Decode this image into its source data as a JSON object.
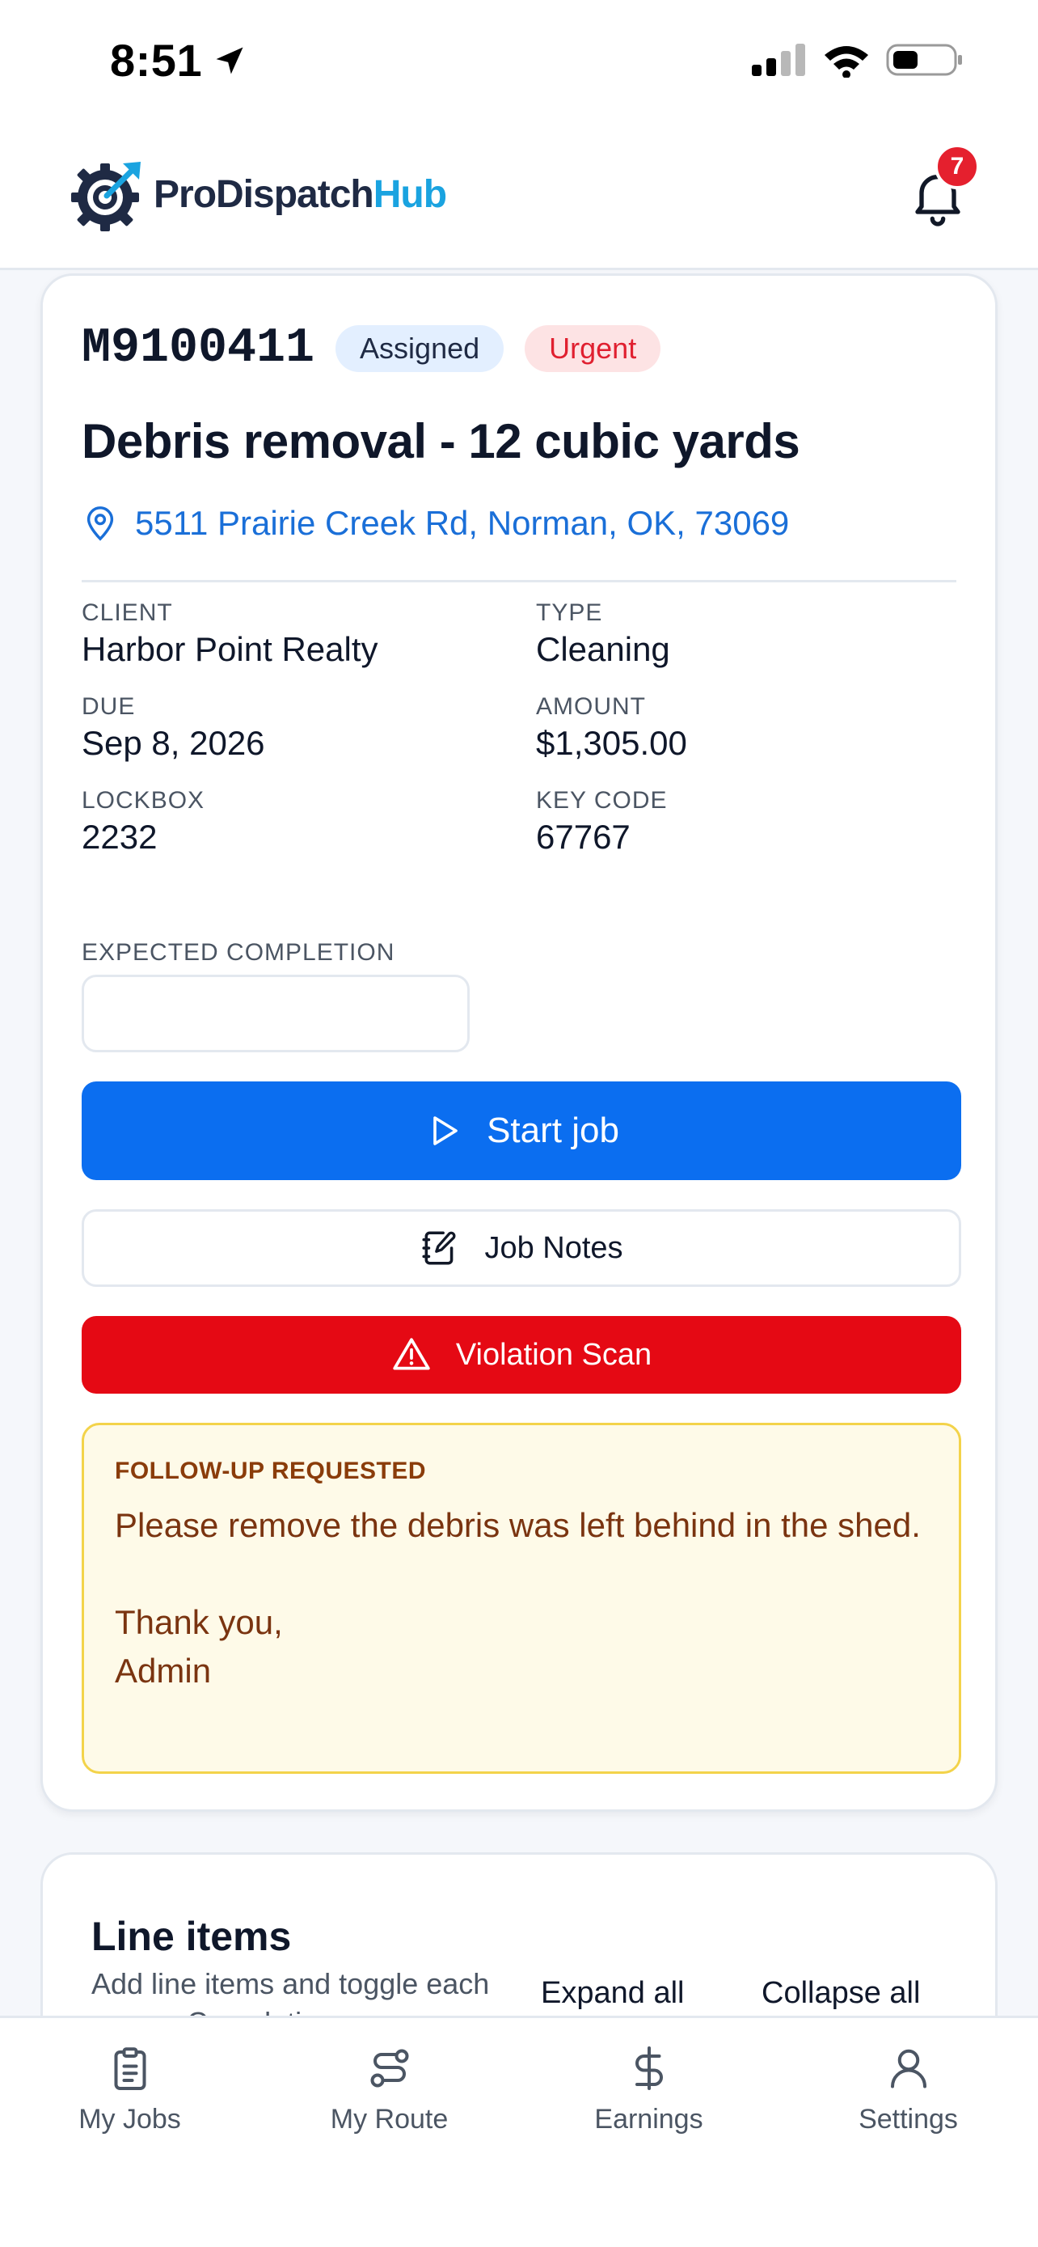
{
  "status_bar": {
    "time": "8:51"
  },
  "header": {
    "logo_pro": "ProDispatch",
    "logo_hub": "Hub",
    "notification_count": "7"
  },
  "job": {
    "id": "M9100411",
    "status": "Assigned",
    "priority": "Urgent",
    "title": "Debris removal - 12 cubic yards",
    "address": "5511 Prairie Creek Rd, Norman, OK, 73069",
    "fields": [
      {
        "label": "CLIENT",
        "value": "Harbor Point Realty"
      },
      {
        "label": "TYPE",
        "value": "Cleaning"
      },
      {
        "label": "DUE",
        "value": "Sep 8, 2026"
      },
      {
        "label": "AMOUNT",
        "value": "$1,305.00"
      },
      {
        "label": "LOCKBOX",
        "value": "2232"
      },
      {
        "label": "KEY CODE",
        "value": "67767"
      }
    ],
    "expected_completion_label": "EXPECTED COMPLETION",
    "expected_completion_value": ""
  },
  "actions": {
    "start_label": "Start job",
    "notes_label": "Job Notes",
    "scan_label": "Violation Scan"
  },
  "followup": {
    "title": "FOLLOW-UP REQUESTED",
    "body": "Please remove the debris was left behind in the shed.\n\nThank you,\nAdmin"
  },
  "line_items": {
    "title": "Line items",
    "description": "Add line items and toggle each one as Completion or",
    "expand_label": "Expand all",
    "collapse_label": "Collapse all"
  },
  "nav": [
    {
      "label": "My Jobs",
      "icon": "clipboard-icon"
    },
    {
      "label": "My Route",
      "icon": "route-icon"
    },
    {
      "label": "Earnings",
      "icon": "dollar-icon"
    },
    {
      "label": "Settings",
      "icon": "user-icon"
    }
  ],
  "colors": {
    "primary": "#0b6ef0",
    "danger": "#e50914",
    "brand_blue": "#1aa3e0",
    "warning_bg": "#fefae8"
  }
}
